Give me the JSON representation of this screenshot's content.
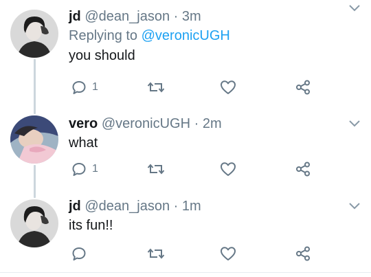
{
  "tweets": [
    {
      "name": "jd",
      "handle": "@dean_jason",
      "separator": "·",
      "time": "3m",
      "replying_prefix": "Replying to ",
      "replying_handle": "@veronicUGH",
      "text": "you should",
      "reply_count": "1",
      "avatar_icon": "profile-photo-jd"
    },
    {
      "name": "vero",
      "handle": "@veronicUGH",
      "separator": "·",
      "time": "2m",
      "text": "what",
      "reply_count": "1",
      "avatar_icon": "profile-photo-vero"
    },
    {
      "name": "jd",
      "handle": "@dean_jason",
      "separator": "·",
      "time": "1m",
      "text": "its fun!!",
      "reply_count": "",
      "avatar_icon": "profile-photo-jd"
    }
  ],
  "colors": {
    "link": "#1da1f2",
    "muted": "#657786",
    "thread_line": "#ccd6dd"
  }
}
